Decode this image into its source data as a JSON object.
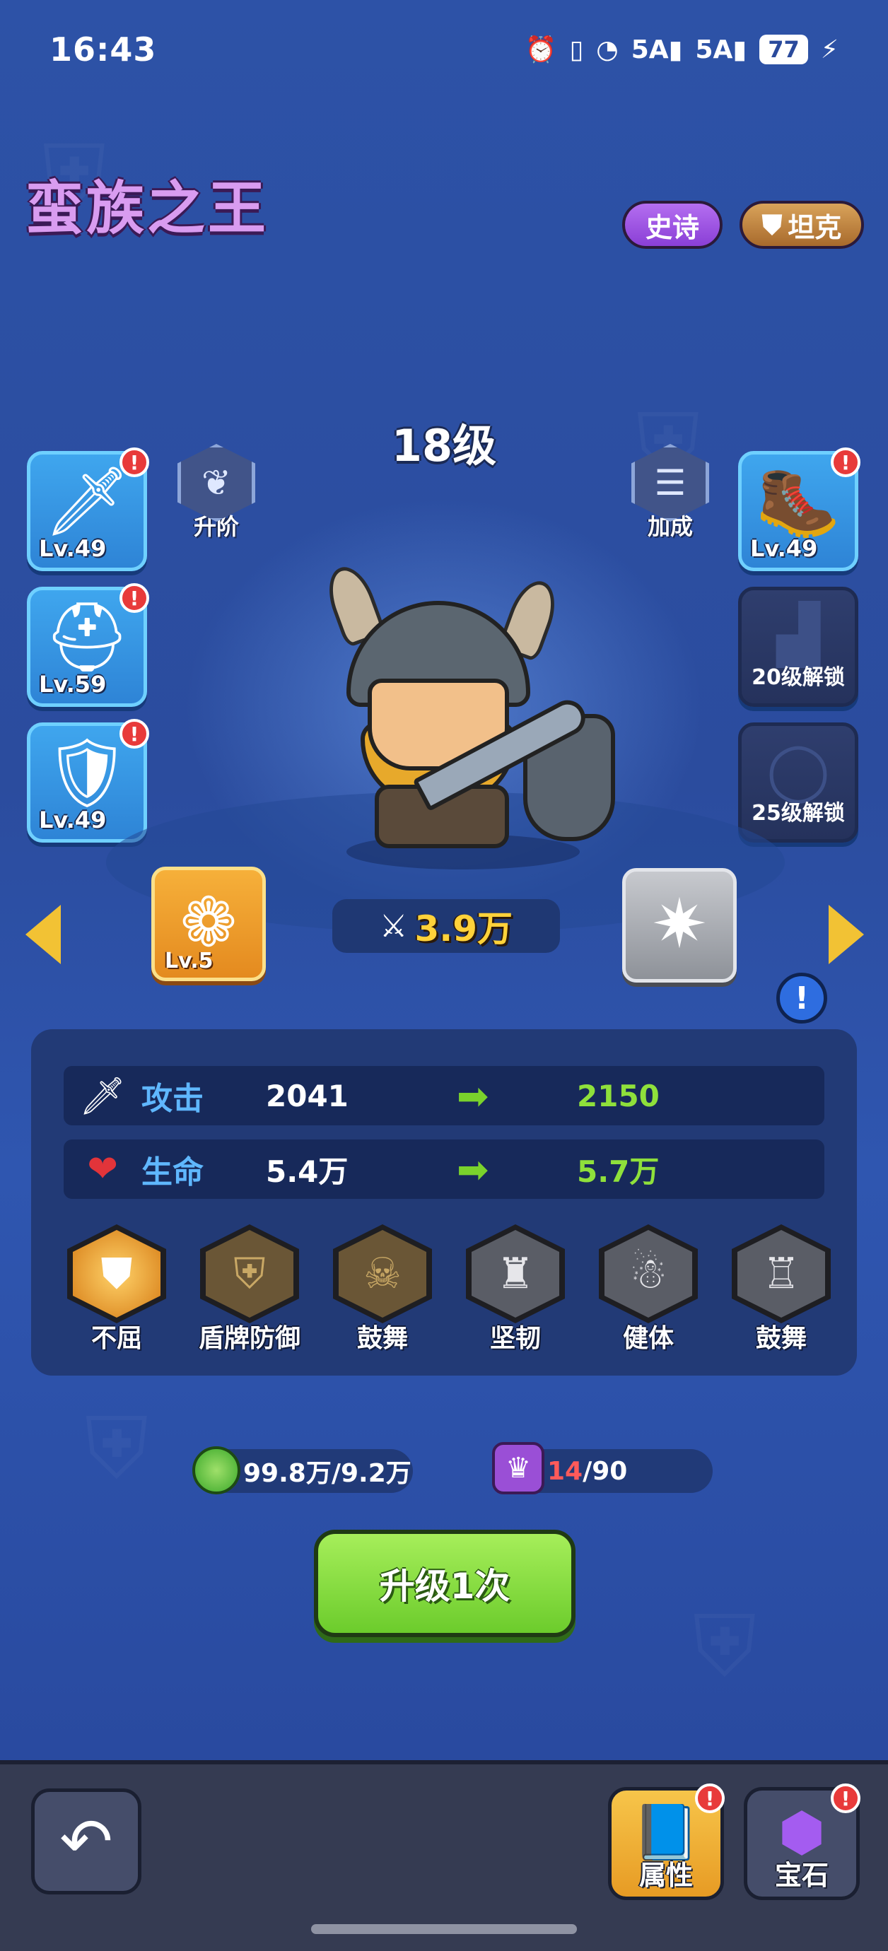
{
  "status_bar": {
    "time": "16:43",
    "signal1": "5A",
    "signal2": "5A",
    "battery": "77"
  },
  "hero": {
    "name": "蛮族之王",
    "rarity": "史诗",
    "role": "坦克",
    "level": "18级"
  },
  "actions": {
    "ascend": "升阶",
    "bonus": "加成"
  },
  "equipment": {
    "left": [
      {
        "icon": "sword-icon",
        "level": "Lv.49"
      },
      {
        "icon": "helmet-icon",
        "level": "Lv.59"
      },
      {
        "icon": "armor-icon",
        "level": "Lv.49"
      }
    ],
    "right": [
      {
        "icon": "boots-icon",
        "level": "Lv.49"
      },
      {
        "icon": "pants-icon",
        "locked_text": "20级解锁"
      },
      {
        "icon": "ring-icon",
        "locked_text": "25级解锁"
      }
    ]
  },
  "gems": {
    "left_level": "Lv.5"
  },
  "power": "3.9万",
  "stats": {
    "attack": {
      "name": "攻击",
      "current": "2041",
      "next": "2150"
    },
    "hp": {
      "name": "生命",
      "current": "5.4万",
      "next": "5.7万"
    }
  },
  "skills": [
    "不屈",
    "盾牌防御",
    "鼓舞",
    "坚韧",
    "健体",
    "鼓舞"
  ],
  "resources": {
    "exp": "99.8万/9.2万",
    "shards_have": "14",
    "shards_need": "/90"
  },
  "upgrade_button": "升级1次",
  "bottom_nav": {
    "attributes": "属性",
    "gems": "宝石"
  },
  "colors": {
    "accent_green": "#8fe03b",
    "title_purple": "#d99cf0",
    "gold": "#ffd23a"
  }
}
